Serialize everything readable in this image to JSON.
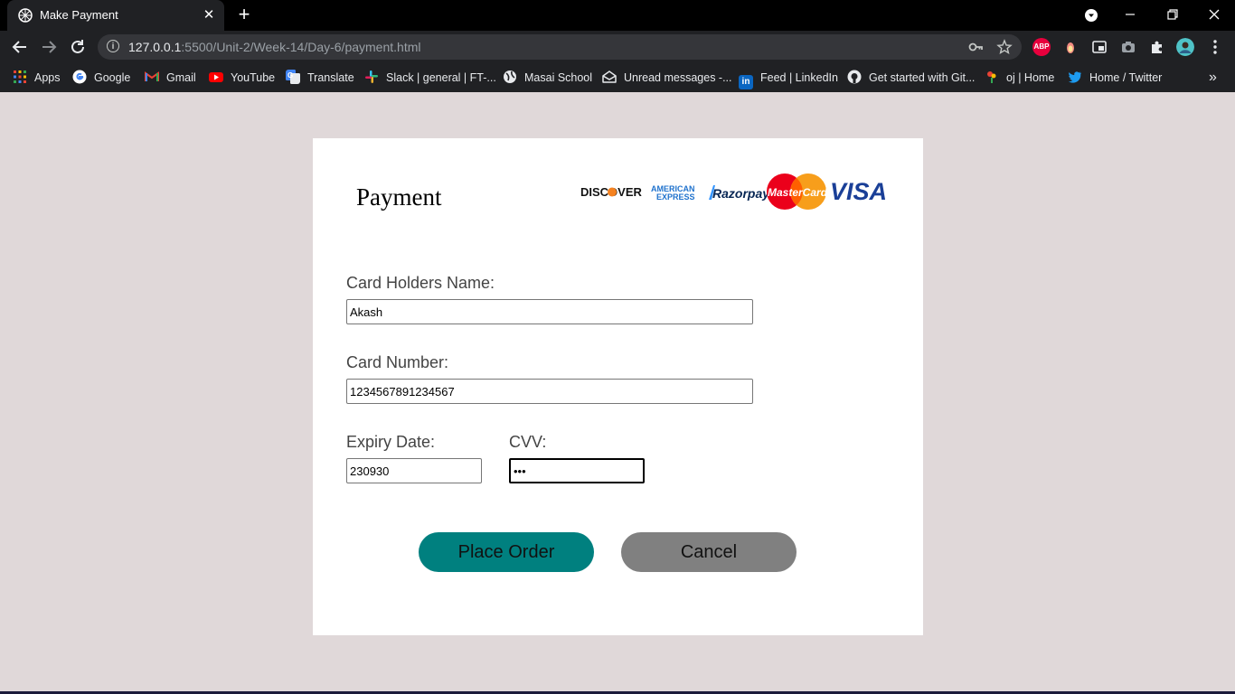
{
  "browser": {
    "tab_title": "Make Payment",
    "tab_close": "✕",
    "new_tab": "+",
    "url_host": "127.0.0.1",
    "url_path": ":5500/Unit-2/Week-14/Day-6/payment.html",
    "extension_abp": "ABP",
    "bookmarks": [
      {
        "label": "Apps",
        "icon": "apps-grid-icon"
      },
      {
        "label": "Google",
        "icon": "google-icon"
      },
      {
        "label": "Gmail",
        "icon": "gmail-icon"
      },
      {
        "label": "YouTube",
        "icon": "youtube-icon"
      },
      {
        "label": "Translate",
        "icon": "translate-icon"
      },
      {
        "label": "Slack | general | FT-...",
        "icon": "slack-icon"
      },
      {
        "label": "Masai School",
        "icon": "globe-icon"
      },
      {
        "label": "Unread messages -...",
        "icon": "mail-icon"
      },
      {
        "label": "Feed | LinkedIn",
        "icon": "linkedin-icon"
      },
      {
        "label": "Get started with Git...",
        "icon": "github-icon"
      },
      {
        "label": "oj | Home",
        "icon": "oj-icon"
      },
      {
        "label": "Home / Twitter",
        "icon": "twitter-icon"
      }
    ],
    "bookmarks_overflow": "»"
  },
  "payment": {
    "title": "Payment",
    "logos": {
      "discover": "DISCOVER",
      "amex_top": "AMERICAN",
      "amex_bottom": "EXPRESS",
      "razorpay": "Razorpay",
      "mastercard": "MasterCard",
      "visa": "VISA"
    },
    "card_holder_label": "Card Holders Name:",
    "card_holder_value": "Akash",
    "card_number_label": "Card Number:",
    "card_number_value": "1234567891234567",
    "expiry_label": "Expiry Date:",
    "expiry_value": "230930",
    "cvv_label": "CVV:",
    "cvv_value": "•••",
    "place_order_label": "Place Order",
    "cancel_label": "Cancel"
  },
  "colors": {
    "page_bg": "#e0d8d9",
    "primary_button": "#00807f",
    "secondary_button": "#808080"
  }
}
